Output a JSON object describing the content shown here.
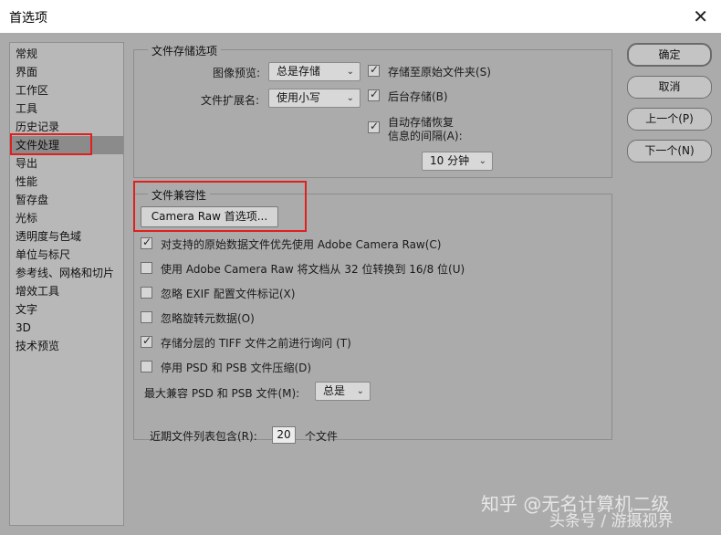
{
  "window": {
    "title": "首选项",
    "close_glyph": "✕"
  },
  "sidebar": {
    "items": [
      {
        "label": "常规"
      },
      {
        "label": "界面"
      },
      {
        "label": "工作区"
      },
      {
        "label": "工具"
      },
      {
        "label": "历史记录"
      },
      {
        "label": "文件处理",
        "selected": true
      },
      {
        "label": "导出"
      },
      {
        "label": "性能"
      },
      {
        "label": "暂存盘"
      },
      {
        "label": "光标"
      },
      {
        "label": "透明度与色域"
      },
      {
        "label": "单位与标尺"
      },
      {
        "label": "参考线、网格和切片"
      },
      {
        "label": "增效工具"
      },
      {
        "label": "文字"
      },
      {
        "label": "3D"
      },
      {
        "label": "技术预览"
      }
    ]
  },
  "file_saving": {
    "group_title": "文件存储选项",
    "image_preview_label": "图像预览:",
    "image_preview_value": "总是存储",
    "extension_label": "文件扩展名:",
    "extension_value": "使用小写",
    "save_to_original": {
      "label": "存储至原始文件夹(S)",
      "checked": true
    },
    "background_save": {
      "label": "后台存储(B)",
      "checked": true
    },
    "autosave": {
      "label_line1": "自动存储恢复",
      "label_line2": "信息的间隔(A):",
      "checked": true
    },
    "interval_value": "10 分钟"
  },
  "compat": {
    "group_title": "文件兼容性",
    "camera_raw_button": "Camera Raw 首选项...",
    "options": [
      {
        "label": "对支持的原始数据文件优先使用 Adobe Camera Raw(C)",
        "checked": true
      },
      {
        "label": "使用 Adobe Camera Raw 将文档从 32 位转换到 16/8 位(U)",
        "checked": false
      },
      {
        "label": "忽略 EXIF 配置文件标记(X)",
        "checked": false
      },
      {
        "label": "忽略旋转元数据(O)",
        "checked": false
      },
      {
        "label": "存储分层的 TIFF 文件之前进行询问 (T)",
        "checked": true
      },
      {
        "label": "停用 PSD 和 PSB 文件压缩(D)",
        "checked": false
      }
    ],
    "max_compat_label": "最大兼容 PSD 和 PSB 文件(M):",
    "max_compat_value": "总是"
  },
  "recent": {
    "label": "近期文件列表包含(R):",
    "value": "20",
    "suffix": "个文件"
  },
  "buttons": {
    "ok": "确定",
    "cancel": "取消",
    "prev": "上一个(P)",
    "next": "下一个(N)"
  },
  "watermark": {
    "line1": "知乎 @无名计算机二级",
    "line2": "头条号 / 游摄视界"
  },
  "colors": {
    "dialog_bg": "#ababab",
    "highlight_red": "#e0201e",
    "selected_item": "#8b8b8b"
  }
}
